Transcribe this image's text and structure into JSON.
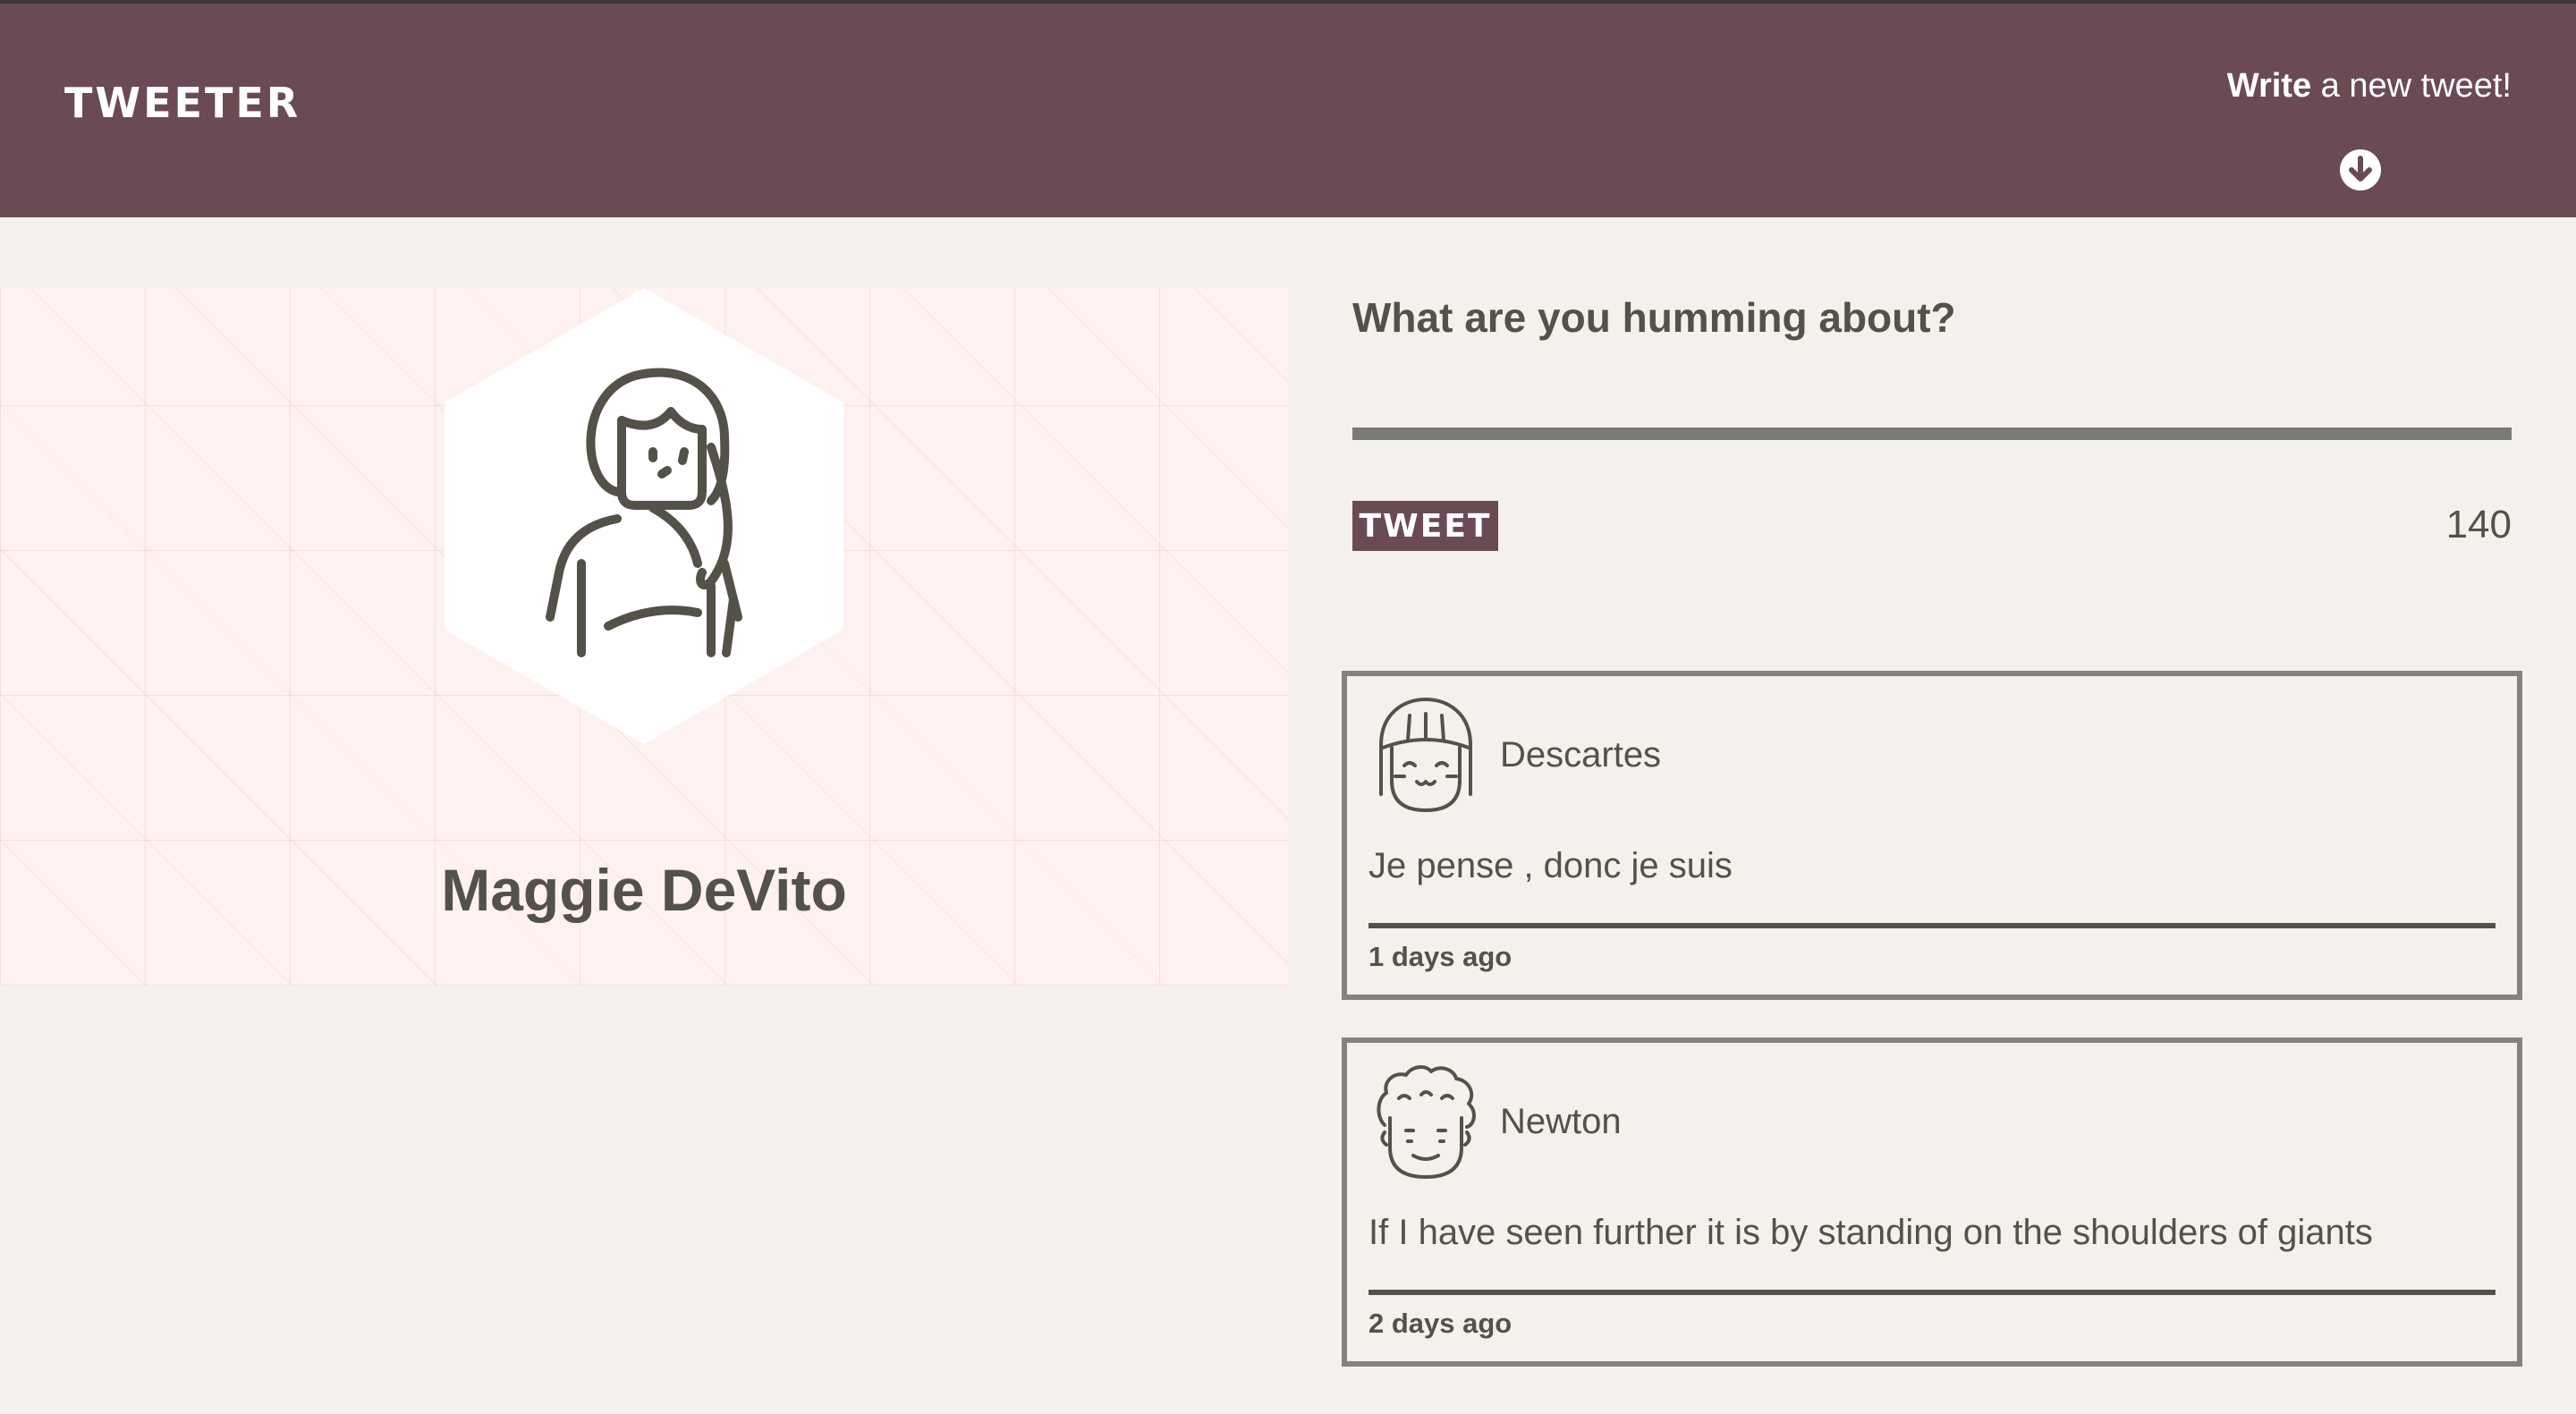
{
  "nav": {
    "brand": "TWEETER",
    "compose_bold": "Write",
    "compose_rest": " a new tweet!",
    "arrow_icon": "arrow-down-circle-icon"
  },
  "profile": {
    "name": "Maggie DeVito",
    "avatar_icon": "woman-avatar-icon"
  },
  "compose": {
    "label": "What are you humming about?",
    "value": "",
    "button_label": "TWEET",
    "counter": "140"
  },
  "tweets": [
    {
      "author": "Descartes",
      "avatar_icon": "girl-avatar-icon",
      "text": "Je pense , donc je suis",
      "date": "1 days ago"
    },
    {
      "author": "Newton",
      "avatar_icon": "curly-hair-avatar-icon",
      "text": "If I have seen further it is by standing on the shoulders of giants",
      "date": "2 days ago"
    }
  ],
  "colors": {
    "nav": "#6a4b53",
    "page": "#f4f1ec",
    "profile_bg": "#fff1ef",
    "text": "#545149",
    "tweet_border": "#838383"
  }
}
